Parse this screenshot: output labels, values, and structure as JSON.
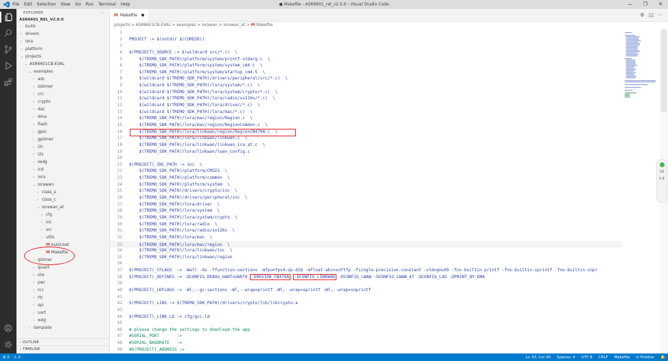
{
  "window": {
    "title": "● Makefile - ASR6601_rel_v2.0.0 - Visual Studio Code",
    "menu": [
      "File",
      "Edit",
      "Selection",
      "View",
      "Go",
      "Run",
      "Terminal",
      "Help"
    ],
    "controls": [
      "—",
      "❐",
      "✕"
    ]
  },
  "sidebar": {
    "header": "EXPLORER",
    "more": "···",
    "root": "ASR6601_REL_V2.0.0",
    "tree": [
      {
        "label": "build",
        "depth": 0,
        "chev": ">"
      },
      {
        "label": "drivers",
        "depth": 0,
        "chev": ">"
      },
      {
        "label": "lora",
        "depth": 0,
        "chev": ">"
      },
      {
        "label": "platform",
        "depth": 0,
        "chev": ">"
      },
      {
        "label": "projects",
        "depth": 0,
        "chev": "v"
      },
      {
        "label": "ASR6601CB-EVAL",
        "depth": 1,
        "chev": "v"
      },
      {
        "label": "examples",
        "depth": 2,
        "chev": "v"
      },
      {
        "label": "adc",
        "depth": 3,
        "chev": ">"
      },
      {
        "label": "bstimer",
        "depth": 3,
        "chev": ">"
      },
      {
        "label": "crc",
        "depth": 3,
        "chev": ">"
      },
      {
        "label": "crypto",
        "depth": 3,
        "chev": ">"
      },
      {
        "label": "dac",
        "depth": 3,
        "chev": ">"
      },
      {
        "label": "dma",
        "depth": 3,
        "chev": ">"
      },
      {
        "label": "flash",
        "depth": 3,
        "chev": ">"
      },
      {
        "label": "gpio",
        "depth": 3,
        "chev": ">"
      },
      {
        "label": "gptimer",
        "depth": 3,
        "chev": ">"
      },
      {
        "label": "i2c",
        "depth": 3,
        "chev": ">"
      },
      {
        "label": "i2s",
        "depth": 3,
        "chev": ">"
      },
      {
        "label": "iwdg",
        "depth": 3,
        "chev": ">"
      },
      {
        "label": "lcd",
        "depth": 3,
        "chev": ">"
      },
      {
        "label": "lora",
        "depth": 3,
        "chev": ">"
      },
      {
        "label": "lorawan",
        "depth": 3,
        "chev": "v"
      },
      {
        "label": "class_a",
        "depth": 4,
        "chev": ">"
      },
      {
        "label": "class_c",
        "depth": 4,
        "chev": ">"
      },
      {
        "label": "lorawan_at",
        "depth": 4,
        "chev": "v"
      },
      {
        "label": "cfg",
        "depth": 5,
        "chev": ">"
      },
      {
        "label": "inc",
        "depth": 5,
        "chev": ">"
      },
      {
        "label": "src",
        "depth": 5,
        "chev": ">"
      },
      {
        "label": "utils",
        "depth": 5,
        "chev": ">"
      },
      {
        "label": "build.bat",
        "depth": 5,
        "chev": "",
        "icon": "M"
      },
      {
        "label": "Makefile",
        "depth": 5,
        "chev": "",
        "icon": "M"
      },
      {
        "label": "lptimer",
        "depth": 3,
        "chev": ">"
      },
      {
        "label": "lpuart",
        "depth": 3,
        "chev": ">"
      },
      {
        "label": "ota",
        "depth": 3,
        "chev": ">"
      },
      {
        "label": "pwr",
        "depth": 3,
        "chev": ">"
      },
      {
        "label": "rcc",
        "depth": 3,
        "chev": ">"
      },
      {
        "label": "rtc",
        "depth": 3,
        "chev": ">"
      },
      {
        "label": "spi",
        "depth": 3,
        "chev": ">"
      },
      {
        "label": "uart",
        "depth": 3,
        "chev": ">"
      },
      {
        "label": "wdg",
        "depth": 3,
        "chev": ">"
      },
      {
        "label": "template",
        "depth": 2,
        "chev": ">"
      }
    ],
    "outline": "OUTLINE",
    "timeline": "TIMELINE"
  },
  "editor": {
    "tab": {
      "icon": "M",
      "label": "Makefile"
    },
    "tab_actions": [
      "⚙",
      "▯▯",
      "···"
    ],
    "breadcrumb": {
      "path": "projects > ASR6601CB-EVAL > examples > lorawan > lorawan_at > ",
      "icon": "M",
      "file": "Makefile"
    },
    "lines": [
      {
        "n": "1",
        "t": ""
      },
      {
        "n": "2",
        "t": "PROJECT := $(notdir $(CURDIR))"
      },
      {
        "n": "3",
        "t": ""
      },
      {
        "n": "4",
        "t": "$(PROJECT)_SOURCE := $(wildcard src/*.c)  \\"
      },
      {
        "n": "5",
        "t": "    $(TREMO_SDK_PATH)/platform/system/printf-stdarg.c  \\"
      },
      {
        "n": "6",
        "t": "    $(TREMO_SDK_PATH)/platform/system/system_cm4.c  \\"
      },
      {
        "n": "7",
        "t": "    $(TREMO_SDK_PATH)/platform/system/startup_cm4.S  \\"
      },
      {
        "n": "8",
        "t": "    $(wildcard $(TREMO_SDK_PATH)/drivers/peripheral/src/*.c)  \\"
      },
      {
        "n": "9",
        "t": "    $(wildcard $(TREMO_SDK_PATH)/lora/system/*.c)  \\"
      },
      {
        "n": "10",
        "t": "    $(wildcard $(TREMO_SDK_PATH)/lora/system/crypto/*.c)  \\"
      },
      {
        "n": "11",
        "t": "    $(wildcard $(TREMO_SDK_PATH)/lora/radio/sx126x/*.c)  \\"
      },
      {
        "n": "12",
        "t": "    $(wildcard $(TREMO_SDK_PATH)/lora/driver/*.c)  \\"
      },
      {
        "n": "13",
        "t": "    $(wildcard $(TREMO_SDK_PATH)/lora/mac/*.c)  \\"
      },
      {
        "n": "14",
        "t": "    $(TREMO_SDK_PATH)/lora/mac/region/Region.c  \\"
      },
      {
        "n": "15",
        "t": "    $(TREMO_SDK_PATH)/lora/mac/region/RegionCommon.c  \\"
      },
      {
        "n": "16",
        "t": "    $(TREMO_SDK_PATH)/lora/linkwan/region/RegionCN470A.c  \\"
      },
      {
        "n": "17",
        "t": "    $(TREMO_SDK_PATH)/lora/linkwan/linkwan.c  \\"
      },
      {
        "n": "18",
        "t": "    $(TREMO_SDK_PATH)/lora/linkwan/linkwan_ica_at.c  \\"
      },
      {
        "n": "19",
        "t": "    $(TREMO_SDK_PATH)/lora/linkwan/lwan_config.c"
      },
      {
        "n": "20",
        "t": ""
      },
      {
        "n": "21",
        "t": "$(PROJECT)_INC_PATH := inc  \\"
      },
      {
        "n": "22",
        "t": "    $(TREMO_SDK_PATH)/platform/CMSIS  \\"
      },
      {
        "n": "23",
        "t": "    $(TREMO_SDK_PATH)/platform/common  \\"
      },
      {
        "n": "24",
        "t": "    $(TREMO_SDK_PATH)/platform/system  \\"
      },
      {
        "n": "25",
        "t": "    $(TREMO_SDK_PATH)/drivers/crypto/inc  \\"
      },
      {
        "n": "26",
        "t": "    $(TREMO_SDK_PATH)/drivers/peripheral/inc  \\"
      },
      {
        "n": "27",
        "t": "    $(TREMO_SDK_PATH)/lora/driver  \\"
      },
      {
        "n": "28",
        "t": "    $(TREMO_SDK_PATH)/lora/system  \\"
      },
      {
        "n": "29",
        "t": "    $(TREMO_SDK_PATH)/lora/system/crypto  \\"
      },
      {
        "n": "30",
        "t": "    $(TREMO_SDK_PATH)/lora/radio  \\"
      },
      {
        "n": "31",
        "t": "    $(TREMO_SDK_PATH)/lora/radio/sx126x  \\"
      },
      {
        "n": "32",
        "t": "    $(TREMO_SDK_PATH)/lora/mac  \\"
      },
      {
        "n": "33",
        "t": "    $(TREMO_SDK_PATH)/lora/mac/region  \\"
      },
      {
        "n": "34",
        "t": "    $(TREMO_SDK_PATH)/lora/linkwan/inc  \\"
      },
      {
        "n": "35",
        "t": "    $(TREMO_SDK_PATH)/lora/linkwan/region"
      },
      {
        "n": "36",
        "t": ""
      },
      {
        "n": "37",
        "t": "$(PROJECT)_CFLAGS  := -Wall -Os -ffunction-sections -mfpu=fpv4-sp-d16 -mfloat-abi=softfp -fsingle-precision-constant -std=gnu99 -fno-builtin-printf -fno-builtin-sprintf -fno-builtin-snpr"
      },
      {
        "n": "38",
        "t": "$(PROJECT)_DEFINES := -DCONFIG_DEBUG_UART=UART0 ",
        "h1": "-DREGION_CN470A",
        "mid": " ",
        "h2": "-DCONFIG_LINKWAN",
        "rest": " -DCONFIG_LWAN -DCONFIG_LWAN_AT -DCONFIG_LOG -DPRINT_BY_DMA"
      },
      {
        "n": "39",
        "t": ""
      },
      {
        "n": "40",
        "t": "$(PROJECT)_LDFLAGS := -Wl,--gc-sections -Wl,--wrap=printf -Wl,--wrap=sprintf -Wl,--wrap=snprintf"
      },
      {
        "n": "41",
        "t": ""
      },
      {
        "n": "42",
        "t": "$(PROJECT)_LIBS := $(TREMO_SDK_PATH)/drivers/crypto/lib/libcrypto.a"
      },
      {
        "n": "43",
        "t": ""
      },
      {
        "n": "44",
        "t": "$(PROJECT)_LINK_LD := cfg/gcc.ld"
      },
      {
        "n": "45",
        "t": ""
      },
      {
        "n": "46",
        "t": "# please change the settings to download the app",
        "comment": true
      },
      {
        "n": "47",
        "t": "#SERIAL_PORT       :=",
        "comment": true
      },
      {
        "n": "48",
        "t": "#SERIAL_BAUDRATE   :=",
        "comment": true
      },
      {
        "n": "49",
        "t": "#$(PROJECT)_ADDRESS :=",
        "comment": true
      }
    ]
  },
  "status": {
    "left": [
      "⊗ 0",
      "⚠ 0"
    ],
    "right": [
      "Ln 33, Col 40",
      "Spaces: 4",
      "UTF-8",
      "CRLF",
      "Makefile",
      "⊙ Prettier",
      "🔔"
    ]
  },
  "float_widget": [
    "18",
    "1.4"
  ],
  "colors": {
    "accent": "#007acc",
    "annotation": "#e02020",
    "keyword": "#2c3e9e",
    "comment": "#098658"
  }
}
